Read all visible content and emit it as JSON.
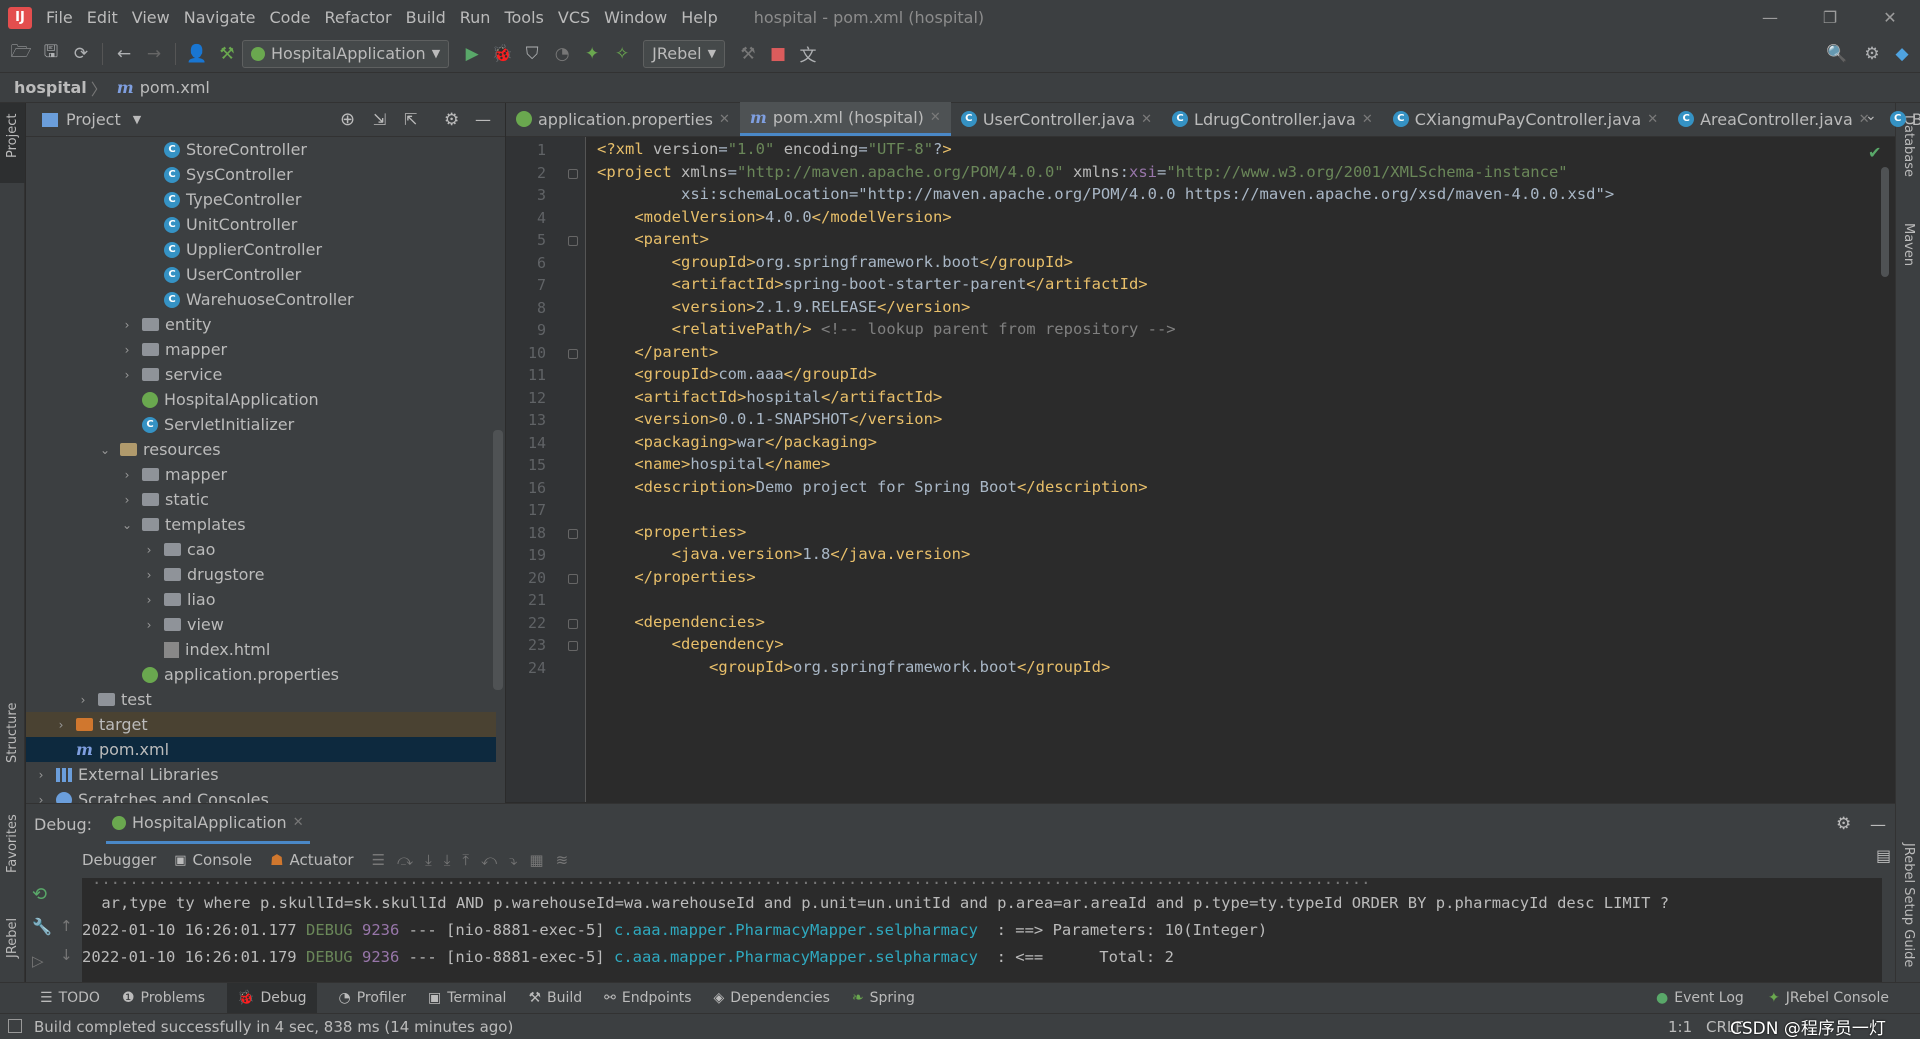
{
  "window": {
    "title": "hospital - pom.xml (hospital)"
  },
  "menu": [
    "File",
    "Edit",
    "View",
    "Navigate",
    "Code",
    "Refactor",
    "Build",
    "Run",
    "Tools",
    "VCS",
    "Window",
    "Help"
  ],
  "toolbar": {
    "run_config": "HospitalApplication",
    "jrebel": "JRebel"
  },
  "breadcrumb": {
    "project": "hospital",
    "file": "pom.xml"
  },
  "project_panel": {
    "title": "Project",
    "tree": [
      {
        "label": "StoreController",
        "kind": "class",
        "indent": 4
      },
      {
        "label": "SysController",
        "kind": "class",
        "indent": 4
      },
      {
        "label": "TypeController",
        "kind": "class",
        "indent": 4
      },
      {
        "label": "UnitController",
        "kind": "class",
        "indent": 4
      },
      {
        "label": "UpplierController",
        "kind": "class",
        "indent": 4
      },
      {
        "label": "UserController",
        "kind": "class",
        "indent": 4
      },
      {
        "label": "WarehuoseController",
        "kind": "class",
        "indent": 4
      },
      {
        "label": "entity",
        "kind": "folder",
        "indent": 3,
        "arrow": "right"
      },
      {
        "label": "mapper",
        "kind": "folder",
        "indent": 3,
        "arrow": "right"
      },
      {
        "label": "service",
        "kind": "folder",
        "indent": 3,
        "arrow": "right"
      },
      {
        "label": "HospitalApplication",
        "kind": "spring",
        "indent": 3
      },
      {
        "label": "ServletInitializer",
        "kind": "class",
        "indent": 3
      },
      {
        "label": "resources",
        "kind": "res",
        "indent": 2,
        "arrow": "down"
      },
      {
        "label": "mapper",
        "kind": "folder",
        "indent": 3,
        "arrow": "right"
      },
      {
        "label": "static",
        "kind": "folder",
        "indent": 3,
        "arrow": "right"
      },
      {
        "label": "templates",
        "kind": "folder",
        "indent": 3,
        "arrow": "down"
      },
      {
        "label": "cao",
        "kind": "folder",
        "indent": 4,
        "arrow": "right"
      },
      {
        "label": "drugstore",
        "kind": "folder",
        "indent": 4,
        "arrow": "right"
      },
      {
        "label": "liao",
        "kind": "folder",
        "indent": 4,
        "arrow": "right"
      },
      {
        "label": "view",
        "kind": "folder",
        "indent": 4,
        "arrow": "right"
      },
      {
        "label": "index.html",
        "kind": "html",
        "indent": 4
      },
      {
        "label": "application.properties",
        "kind": "spring",
        "indent": 3
      },
      {
        "label": "test",
        "kind": "folder",
        "indent": 1,
        "arrow": "right"
      },
      {
        "label": "target",
        "kind": "target",
        "indent": 0,
        "arrow": "right"
      },
      {
        "label": "pom.xml",
        "kind": "maven",
        "indent": 0
      },
      {
        "label": "External Libraries",
        "kind": "lib",
        "indent": -1,
        "arrow": "right"
      },
      {
        "label": "Scratches and Consoles",
        "kind": "scratch",
        "indent": -1,
        "arrow": "right"
      }
    ]
  },
  "tabs": [
    {
      "label": "application.properties",
      "icon": "spring"
    },
    {
      "label": "pom.xml (hospital)",
      "icon": "maven",
      "active": true
    },
    {
      "label": "UserController.java",
      "icon": "class"
    },
    {
      "label": "LdrugController.java",
      "icon": "class"
    },
    {
      "label": "CXiangmuPayController.java",
      "icon": "class"
    },
    {
      "label": "AreaController.java",
      "icon": "class"
    },
    {
      "label": "B",
      "icon": "class"
    }
  ],
  "code": [
    "<?xml version=\"1.0\" encoding=\"UTF-8\"?>",
    "<project xmlns=\"http://maven.apache.org/POM/4.0.0\" xmlns:xsi=\"http://www.w3.org/2001/XMLSchema-instance\"",
    "         xsi:schemaLocation=\"http://maven.apache.org/POM/4.0.0 https://maven.apache.org/xsd/maven-4.0.0.xsd\">",
    "    <modelVersion>4.0.0</modelVersion>",
    "    <parent>",
    "        <groupId>org.springframework.boot</groupId>",
    "        <artifactId>spring-boot-starter-parent</artifactId>",
    "        <version>2.1.9.RELEASE</version>",
    "        <relativePath/> <!-- lookup parent from repository -->",
    "    </parent>",
    "    <groupId>com.aaa</groupId>",
    "    <artifactId>hospital</artifactId>",
    "    <version>0.0.1-SNAPSHOT</version>",
    "    <packaging>war</packaging>",
    "    <name>hospital</name>",
    "    <description>Demo project for Spring Boot</description>",
    "",
    "    <properties>",
    "        <java.version>1.8</java.version>",
    "    </properties>",
    "",
    "    <dependencies>",
    "        <dependency>",
    "            <groupId>org.springframework.boot</groupId>"
  ],
  "line_numbers": [
    "1",
    "2",
    "3",
    "4",
    "5",
    "6",
    "7",
    "8",
    "9",
    "10",
    "11",
    "12",
    "13",
    "14",
    "15",
    "16",
    "17",
    "18",
    "19",
    "20",
    "21",
    "22",
    "23",
    "24"
  ],
  "debug": {
    "label": "Debug:",
    "session": "HospitalApplication",
    "tabs": [
      "Debugger",
      "Console",
      "Actuator"
    ],
    "console": [
      {
        "text": " ar,type ty where p.skullId=sk.skullId AND p.warehouseId=wa.warehouseId and p.unit=un.unitId and p.area=ar.areaId and p.type=ty.typeId ORDER BY p.pharmacyId desc LIMIT ?"
      },
      {
        "time": "2022-01-10 16:26:01.177",
        "level": "DEBUG",
        "pid": "9236",
        "thread": "--- [nio-8881-exec-5]",
        "logger": "c.aaa.mapper.PharmacyMapper.selpharmacy",
        "msg": "  : ==> Parameters: 10(Integer)"
      },
      {
        "time": "2022-01-10 16:26:01.179",
        "level": "DEBUG",
        "pid": "9236",
        "thread": "--- [nio-8881-exec-5]",
        "logger": "c.aaa.mapper.PharmacyMapper.selpharmacy",
        "msg": "  : <==      Total: 2"
      }
    ]
  },
  "bottom_tabs": [
    "TODO",
    "Problems",
    "Debug",
    "Profiler",
    "Terminal",
    "Build",
    "Endpoints",
    "Dependencies",
    "Spring"
  ],
  "bottom_right": [
    "Event Log",
    "JRebel Console"
  ],
  "status": {
    "message": "Build completed successfully in 4 sec, 838 ms (14 minutes ago)",
    "position": "1:1",
    "line_sep": "CRLF",
    "watermark": "CSDN @程序员一灯"
  },
  "side_tools": {
    "left": [
      "Project",
      "Structure",
      "Favorites",
      "JRebel"
    ],
    "right": [
      "Database",
      "Maven",
      "JRebel Setup Guide"
    ]
  }
}
